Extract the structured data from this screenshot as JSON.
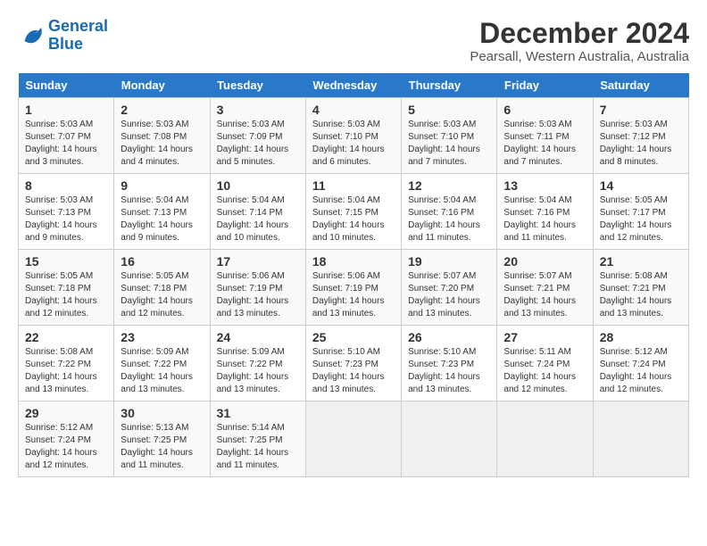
{
  "logo": {
    "line1": "General",
    "line2": "Blue"
  },
  "title": "December 2024",
  "subtitle": "Pearsall, Western Australia, Australia",
  "headers": [
    "Sunday",
    "Monday",
    "Tuesday",
    "Wednesday",
    "Thursday",
    "Friday",
    "Saturday"
  ],
  "weeks": [
    [
      {
        "day": "1",
        "sunrise": "5:03 AM",
        "sunset": "7:07 PM",
        "daylight": "14 hours and 3 minutes."
      },
      {
        "day": "2",
        "sunrise": "5:03 AM",
        "sunset": "7:08 PM",
        "daylight": "14 hours and 4 minutes."
      },
      {
        "day": "3",
        "sunrise": "5:03 AM",
        "sunset": "7:09 PM",
        "daylight": "14 hours and 5 minutes."
      },
      {
        "day": "4",
        "sunrise": "5:03 AM",
        "sunset": "7:10 PM",
        "daylight": "14 hours and 6 minutes."
      },
      {
        "day": "5",
        "sunrise": "5:03 AM",
        "sunset": "7:10 PM",
        "daylight": "14 hours and 7 minutes."
      },
      {
        "day": "6",
        "sunrise": "5:03 AM",
        "sunset": "7:11 PM",
        "daylight": "14 hours and 7 minutes."
      },
      {
        "day": "7",
        "sunrise": "5:03 AM",
        "sunset": "7:12 PM",
        "daylight": "14 hours and 8 minutes."
      }
    ],
    [
      {
        "day": "8",
        "sunrise": "5:03 AM",
        "sunset": "7:13 PM",
        "daylight": "14 hours and 9 minutes."
      },
      {
        "day": "9",
        "sunrise": "5:04 AM",
        "sunset": "7:13 PM",
        "daylight": "14 hours and 9 minutes."
      },
      {
        "day": "10",
        "sunrise": "5:04 AM",
        "sunset": "7:14 PM",
        "daylight": "14 hours and 10 minutes."
      },
      {
        "day": "11",
        "sunrise": "5:04 AM",
        "sunset": "7:15 PM",
        "daylight": "14 hours and 10 minutes."
      },
      {
        "day": "12",
        "sunrise": "5:04 AM",
        "sunset": "7:16 PM",
        "daylight": "14 hours and 11 minutes."
      },
      {
        "day": "13",
        "sunrise": "5:04 AM",
        "sunset": "7:16 PM",
        "daylight": "14 hours and 11 minutes."
      },
      {
        "day": "14",
        "sunrise": "5:05 AM",
        "sunset": "7:17 PM",
        "daylight": "14 hours and 12 minutes."
      }
    ],
    [
      {
        "day": "15",
        "sunrise": "5:05 AM",
        "sunset": "7:18 PM",
        "daylight": "14 hours and 12 minutes."
      },
      {
        "day": "16",
        "sunrise": "5:05 AM",
        "sunset": "7:18 PM",
        "daylight": "14 hours and 12 minutes."
      },
      {
        "day": "17",
        "sunrise": "5:06 AM",
        "sunset": "7:19 PM",
        "daylight": "14 hours and 13 minutes."
      },
      {
        "day": "18",
        "sunrise": "5:06 AM",
        "sunset": "7:19 PM",
        "daylight": "14 hours and 13 minutes."
      },
      {
        "day": "19",
        "sunrise": "5:07 AM",
        "sunset": "7:20 PM",
        "daylight": "14 hours and 13 minutes."
      },
      {
        "day": "20",
        "sunrise": "5:07 AM",
        "sunset": "7:21 PM",
        "daylight": "14 hours and 13 minutes."
      },
      {
        "day": "21",
        "sunrise": "5:08 AM",
        "sunset": "7:21 PM",
        "daylight": "14 hours and 13 minutes."
      }
    ],
    [
      {
        "day": "22",
        "sunrise": "5:08 AM",
        "sunset": "7:22 PM",
        "daylight": "14 hours and 13 minutes."
      },
      {
        "day": "23",
        "sunrise": "5:09 AM",
        "sunset": "7:22 PM",
        "daylight": "14 hours and 13 minutes."
      },
      {
        "day": "24",
        "sunrise": "5:09 AM",
        "sunset": "7:22 PM",
        "daylight": "14 hours and 13 minutes."
      },
      {
        "day": "25",
        "sunrise": "5:10 AM",
        "sunset": "7:23 PM",
        "daylight": "14 hours and 13 minutes."
      },
      {
        "day": "26",
        "sunrise": "5:10 AM",
        "sunset": "7:23 PM",
        "daylight": "14 hours and 13 minutes."
      },
      {
        "day": "27",
        "sunrise": "5:11 AM",
        "sunset": "7:24 PM",
        "daylight": "14 hours and 12 minutes."
      },
      {
        "day": "28",
        "sunrise": "5:12 AM",
        "sunset": "7:24 PM",
        "daylight": "14 hours and 12 minutes."
      }
    ],
    [
      {
        "day": "29",
        "sunrise": "5:12 AM",
        "sunset": "7:24 PM",
        "daylight": "14 hours and 12 minutes."
      },
      {
        "day": "30",
        "sunrise": "5:13 AM",
        "sunset": "7:25 PM",
        "daylight": "14 hours and 11 minutes."
      },
      {
        "day": "31",
        "sunrise": "5:14 AM",
        "sunset": "7:25 PM",
        "daylight": "14 hours and 11 minutes."
      },
      null,
      null,
      null,
      null
    ]
  ]
}
